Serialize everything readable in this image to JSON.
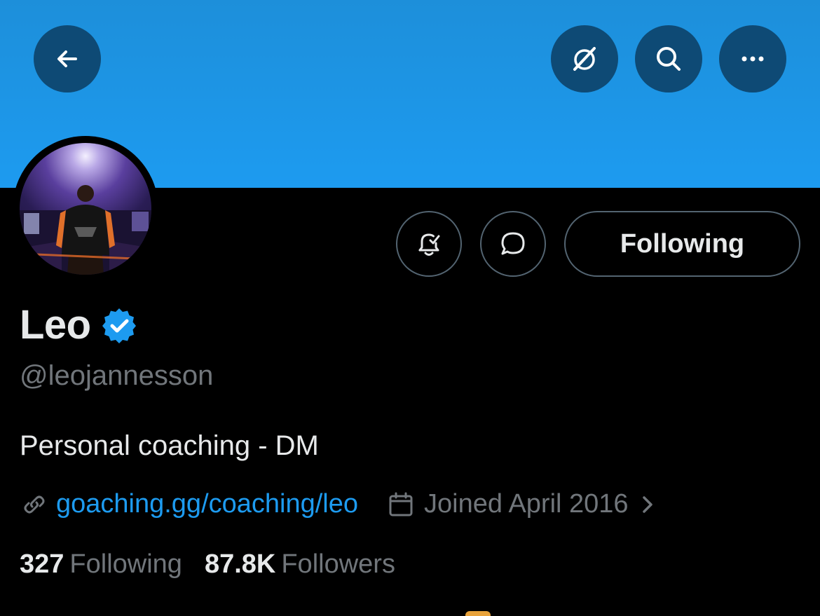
{
  "header": {
    "back_icon": "arrow-left-icon",
    "grok_icon": "grok-icon",
    "search_icon": "search-icon",
    "more_icon": "more-horizontal-icon",
    "banner_color": "#1d9bf0",
    "button_color": "#0e4a75"
  },
  "actions": {
    "notify_icon": "bell-check-icon",
    "message_icon": "message-bubble-icon",
    "following_label": "Following"
  },
  "profile": {
    "name": "Leo",
    "verified_icon": "verified-badge-icon",
    "handle": "@leojannesson",
    "bio": "Personal coaching - DM",
    "link_icon": "link-icon",
    "link": "goaching.gg/coaching/leo",
    "calendar_icon": "calendar-icon",
    "joined": "Joined April 2016",
    "accent_color": "#1d9bf0"
  },
  "stats": {
    "following_count": "327",
    "following_label": "Following",
    "followers_count": "87.8K",
    "followers_label": "Followers"
  }
}
